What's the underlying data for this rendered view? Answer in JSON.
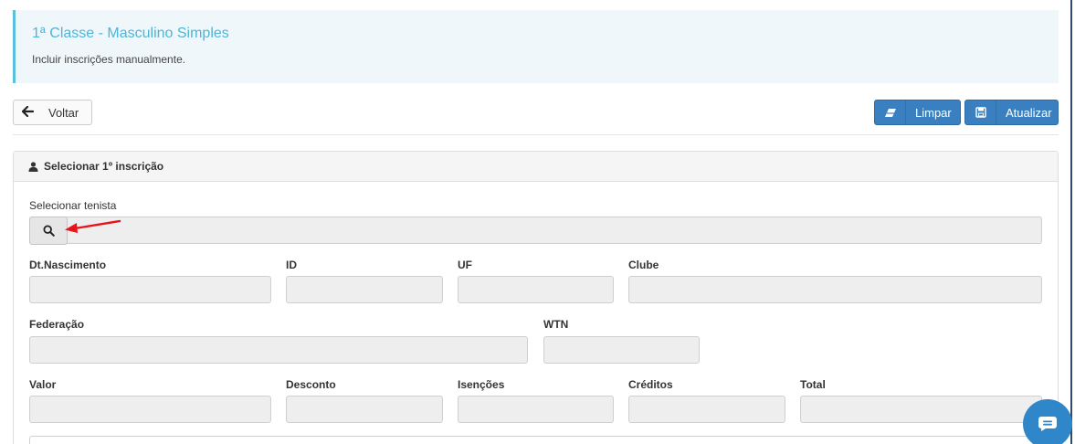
{
  "header": {
    "title": "1ª Classe - Masculino Simples",
    "subtitle": "Incluir inscrições manualmente."
  },
  "toolbar": {
    "back_label": "Voltar",
    "clear_label": "Limpar",
    "update_label": "Atualizar"
  },
  "panel": {
    "title": "Selecionar 1º inscrição",
    "select_player_label": "Selecionar tenista",
    "fields": {
      "birth_date": "Dt.Nascimento",
      "id": "ID",
      "uf": "UF",
      "club": "Clube",
      "federation": "Federação",
      "wtn": "WTN",
      "value": "Valor",
      "discount": "Desconto",
      "exemptions": "Isenções",
      "credits": "Créditos",
      "total": "Total"
    }
  },
  "icons": {
    "back": "arrow-left-icon",
    "clear": "eraser-icon",
    "update": "save-icon",
    "panel": "user-icon",
    "search": "search-icon",
    "chat": "chat-icon",
    "pointer": "red-arrow-annotation"
  },
  "colors": {
    "accent": "#3a80c0",
    "callout_border": "#5bc0de",
    "callout_title": "#4fb5d6",
    "chat_button": "#2f86c8",
    "annotation_arrow": "#e8141a"
  }
}
